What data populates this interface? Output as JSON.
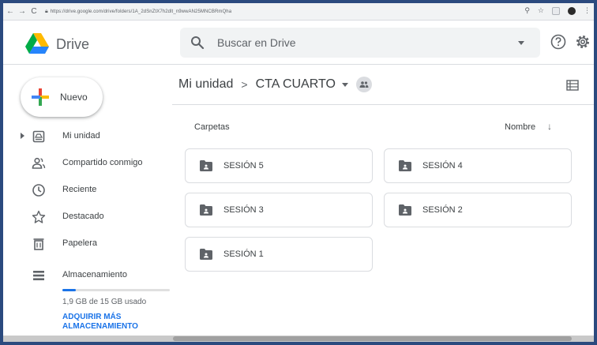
{
  "browser": {
    "back": "←",
    "forward": "→",
    "reload": "C",
    "url": "https://drive.google.com/drive/folders/1A_2dSnZtX7h2dlt_n9wwAN25MNCBRmQha"
  },
  "header": {
    "brand": "Drive",
    "search_placeholder": "Buscar en Drive"
  },
  "sidebar": {
    "new_button": "Nuevo",
    "items": [
      {
        "label": "Mi unidad",
        "icon": "my-drive-icon"
      },
      {
        "label": "Compartido conmigo",
        "icon": "shared-people-icon"
      },
      {
        "label": "Reciente",
        "icon": "clock-icon"
      },
      {
        "label": "Destacado",
        "icon": "star-icon"
      },
      {
        "label": "Papelera",
        "icon": "trash-icon"
      },
      {
        "label": "Almacenamiento",
        "icon": "storage-icon"
      }
    ],
    "storage_used_fraction": 0.127,
    "storage_text": "1,9 GB de 15 GB usado",
    "buy_storage": "ADQUIRIR MÁS ALMACENAMIENTO"
  },
  "main": {
    "breadcrumb_root": "Mi unidad",
    "breadcrumb_sep": ">",
    "breadcrumb_current": "CTA CUARTO",
    "section_label": "Carpetas",
    "sort_label": "Nombre",
    "sort_arrow": "↓",
    "folders": [
      {
        "name": "SESIÓN 5"
      },
      {
        "name": "SESIÓN 4"
      },
      {
        "name": "SESIÓN 3"
      },
      {
        "name": "SESIÓN 2"
      },
      {
        "name": "SESIÓN 1"
      }
    ]
  },
  "colors": {
    "accent": "#1a73e8",
    "frame": "#2b4a7e",
    "folder_icon": "#5f6368"
  }
}
